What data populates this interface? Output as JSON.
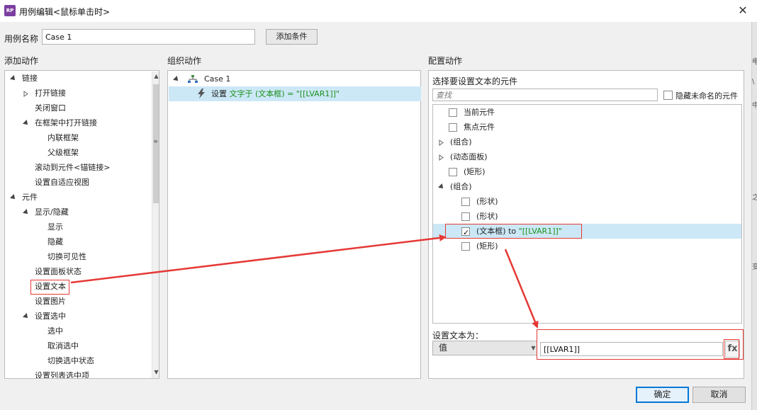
{
  "window": {
    "icon_text": "RP",
    "title": "用例编辑<鼠标单击时>",
    "close_glyph": "✕"
  },
  "case": {
    "label": "用例名称",
    "value": "Case 1",
    "add_condition": "添加条件"
  },
  "panels": {
    "add_action": "添加动作",
    "organize_action": "组织动作",
    "config_action": "配置动作"
  },
  "actions_tree": [
    {
      "label": "链接",
      "indent": 0,
      "toggle": "expanded"
    },
    {
      "label": "打开链接",
      "indent": 1,
      "toggle": "collapsed"
    },
    {
      "label": "关闭窗口",
      "indent": 1,
      "toggle": "none"
    },
    {
      "label": "在框架中打开链接",
      "indent": 1,
      "toggle": "expanded"
    },
    {
      "label": "内联框架",
      "indent": 2,
      "toggle": "none"
    },
    {
      "label": "父级框架",
      "indent": 2,
      "toggle": "none"
    },
    {
      "label": "滚动到元件<锚链接>",
      "indent": 1,
      "toggle": "none"
    },
    {
      "label": "设置自适应视图",
      "indent": 1,
      "toggle": "none"
    },
    {
      "label": "元件",
      "indent": 0,
      "toggle": "expanded"
    },
    {
      "label": "显示/隐藏",
      "indent": 1,
      "toggle": "expanded"
    },
    {
      "label": "显示",
      "indent": 2,
      "toggle": "none"
    },
    {
      "label": "隐藏",
      "indent": 2,
      "toggle": "none"
    },
    {
      "label": "切换可见性",
      "indent": 2,
      "toggle": "none"
    },
    {
      "label": "设置面板状态",
      "indent": 1,
      "toggle": "none"
    },
    {
      "label": "设置文本",
      "indent": 1,
      "toggle": "none",
      "highlight": true
    },
    {
      "label": "设置图片",
      "indent": 1,
      "toggle": "none"
    },
    {
      "label": "设置选中",
      "indent": 1,
      "toggle": "expanded"
    },
    {
      "label": "选中",
      "indent": 2,
      "toggle": "none"
    },
    {
      "label": "取消选中",
      "indent": 2,
      "toggle": "none"
    },
    {
      "label": "切换选中状态",
      "indent": 2,
      "toggle": "none"
    },
    {
      "label": "设置列表选中项",
      "indent": 1,
      "toggle": "none"
    }
  ],
  "organize": {
    "case_label": "Case 1",
    "action_prefix": "设置",
    "action_detail": "文字于 (文本框) = \"[[LVAR1]]\""
  },
  "config": {
    "select_widget_label": "选择要设置文本的元件",
    "search_placeholder": "查找",
    "hide_unnamed": "隐藏未命名的元件",
    "widgets": [
      {
        "label": "当前元件",
        "indent": 0,
        "toggle": "none",
        "checkbox": true,
        "checked": false
      },
      {
        "label": "焦点元件",
        "indent": 0,
        "toggle": "none",
        "checkbox": true,
        "checked": false
      },
      {
        "label": "(组合)",
        "indent": 0,
        "toggle": "collapsed",
        "checkbox": false,
        "checked": false
      },
      {
        "label": "(动态面板)",
        "indent": 0,
        "toggle": "collapsed",
        "checkbox": false,
        "checked": false
      },
      {
        "label": "(矩形)",
        "indent": 0,
        "toggle": "none",
        "checkbox": true,
        "checked": false
      },
      {
        "label": "(组合)",
        "indent": 0,
        "toggle": "expanded",
        "checkbox": false,
        "checked": false
      },
      {
        "label": "(形状)",
        "indent": 1,
        "toggle": "none",
        "checkbox": true,
        "checked": false
      },
      {
        "label": "(形状)",
        "indent": 1,
        "toggle": "none",
        "checkbox": true,
        "checked": false
      },
      {
        "label": "(文本框)",
        "indent": 1,
        "toggle": "none",
        "checkbox": true,
        "checked": true,
        "suffix": " to ",
        "suffix_value": "\"[[LVAR1]]\""
      },
      {
        "label": "(矩形)",
        "indent": 1,
        "toggle": "none",
        "checkbox": true,
        "checked": false
      }
    ],
    "set_text_label": "设置文本为：",
    "value_type": "值",
    "value": "[[LVAR1]]",
    "fx_label": "fx"
  },
  "footer": {
    "ok": "确定",
    "cancel": "取消"
  },
  "right_strip_glyphs": [
    "电",
    "\\",
    "中",
    "之",
    "变"
  ],
  "colors": {
    "selection": "#cce8f7",
    "annotation_red": "#e53935",
    "green_text": "#1a8f1a",
    "accent_blue": "#0078d7"
  }
}
